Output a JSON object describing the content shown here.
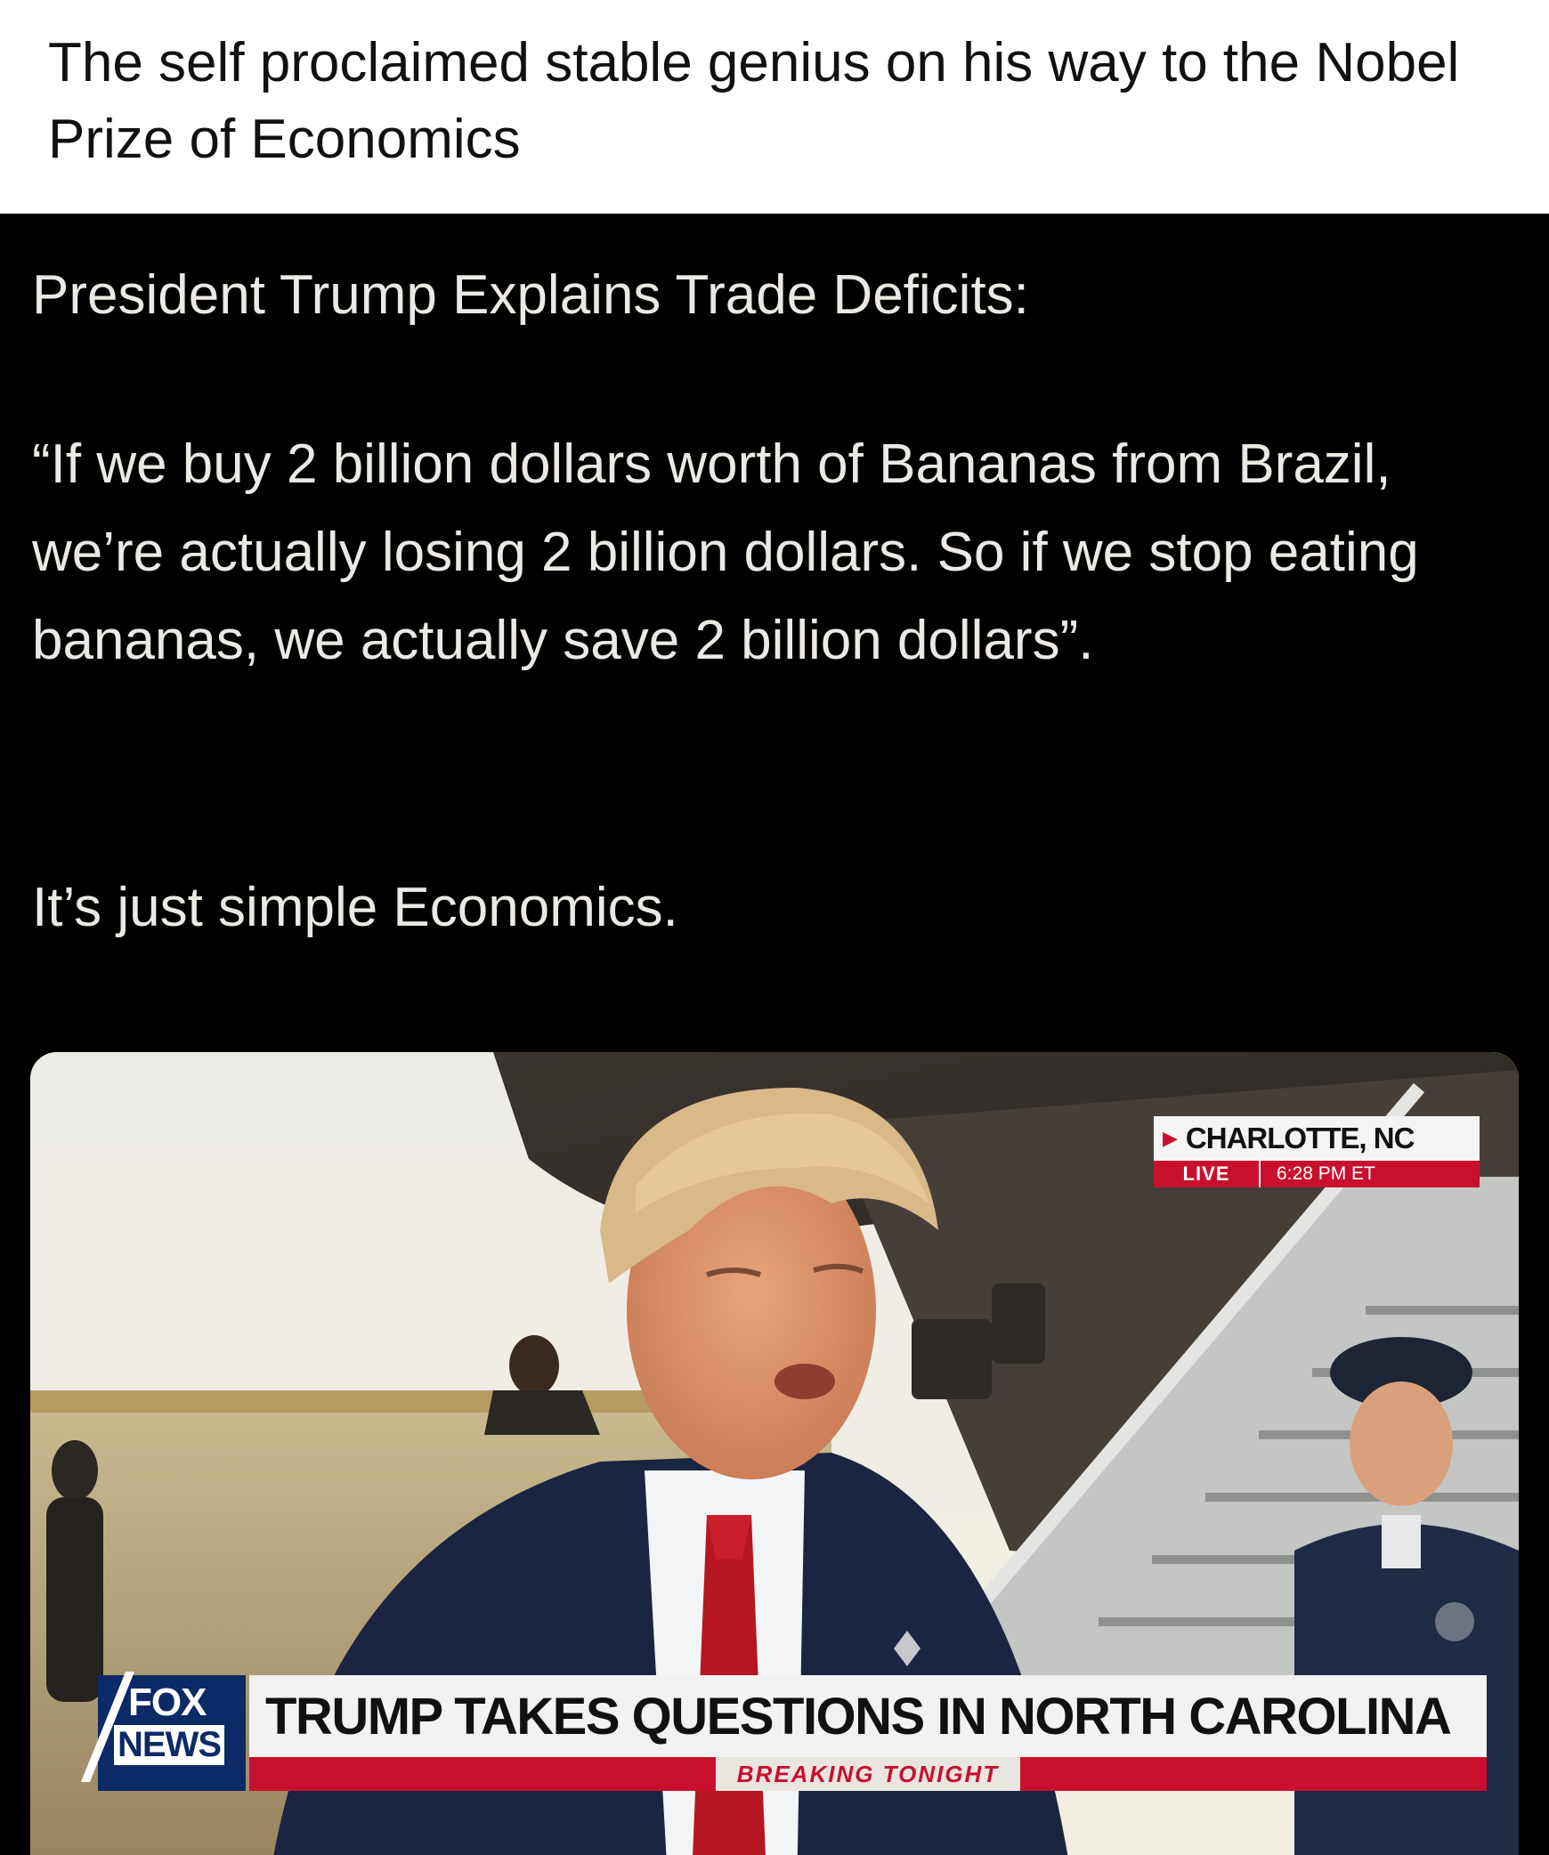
{
  "post": {
    "caption": "The self proclaimed stable genius on his way to the Nobel Prize of Economics"
  },
  "tweet": {
    "heading": "President Trump Explains Trade Deficits:",
    "quote": "“If we buy 2 billion dollars worth of Bananas from Brazil, we’re actually losing 2 billion dollars.  So if we stop eating bananas, we actually save 2 billion dollars”.",
    "conclusion": "It’s just simple Economics."
  },
  "video": {
    "location": "CHARLOTTE, NC",
    "live_label": "LIVE",
    "time": "6:28 PM ET",
    "network_top": "FOX",
    "network_bottom": "NEWS",
    "headline": "TRUMP TAKES QUESTIONS IN NORTH CAROLINA",
    "ticker": "BREAKING TONIGHT"
  },
  "colors": {
    "page_background": "#ffffff",
    "tweet_background": "#000000",
    "tweet_text": "#ece9e4",
    "fox_blue": "#0b2a66",
    "fox_red": "#c8102e"
  }
}
